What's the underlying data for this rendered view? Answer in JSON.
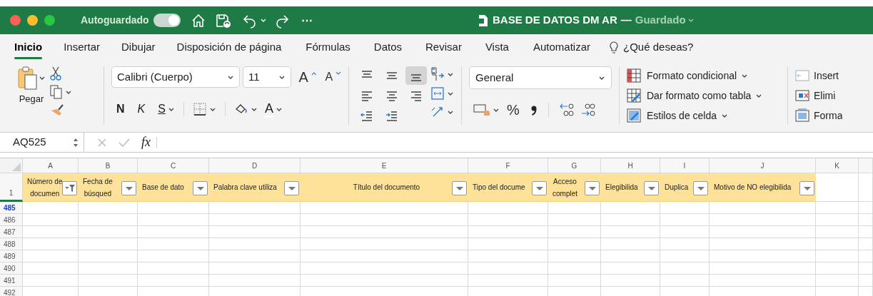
{
  "window": {
    "autosave_label": "Autoguardado",
    "autosave_on": true,
    "more": "⋯",
    "title": "BASE DE DATOS DM AR",
    "separator": "—",
    "status": "Guardado"
  },
  "ribbon_tabs": [
    {
      "label": "Inicio",
      "selected": true
    },
    {
      "label": "Insertar",
      "selected": false
    },
    {
      "label": "Dibujar",
      "selected": false
    },
    {
      "label": "Disposición de página",
      "selected": false
    },
    {
      "label": "Fórmulas",
      "selected": false
    },
    {
      "label": "Datos",
      "selected": false
    },
    {
      "label": "Revisar",
      "selected": false
    },
    {
      "label": "Vista",
      "selected": false
    },
    {
      "label": "Automatizar",
      "selected": false
    }
  ],
  "search": {
    "label": "¿Qué deseas?"
  },
  "clipboard": {
    "paste": "Pegar"
  },
  "font": {
    "name": "Calibri (Cuerpo)",
    "size": "11",
    "grow": "A",
    "shrink": "A",
    "bold": "N",
    "italic": "K",
    "underline": "S",
    "font_color_label": "A"
  },
  "alignment_buttons": [
    {
      "kind": "top",
      "selected": false
    },
    {
      "kind": "middle",
      "selected": false
    },
    {
      "kind": "bottom",
      "selected": true
    },
    {
      "kind": "left",
      "selected": false
    },
    {
      "kind": "center",
      "selected": false
    },
    {
      "kind": "right",
      "selected": false
    },
    {
      "kind": "outdent",
      "selected": false
    },
    {
      "kind": "indent",
      "selected": false
    }
  ],
  "number": {
    "format": "General",
    "percent": "%"
  },
  "styles": [
    "Formato condicional",
    "Dar formato como tabla",
    "Estilos de celda"
  ],
  "cells": [
    "Insert",
    "Elimi",
    "Forma"
  ],
  "formula_bar": {
    "name_box": "AQ525",
    "function": "fx"
  },
  "sheet": {
    "columns": [
      {
        "letter": "A",
        "header_lines": [
          "Número de",
          "documen"
        ],
        "filter_active": true
      },
      {
        "letter": "B",
        "header_lines": [
          "Fecha de",
          "búsqued"
        ],
        "filter_active": false
      },
      {
        "letter": "C",
        "header_lines": [
          "Base de dato"
        ],
        "filter_active": false
      },
      {
        "letter": "D",
        "header_lines": [
          "Palabra clave utiliza"
        ],
        "filter_active": false
      },
      {
        "letter": "E",
        "header_lines": [
          "Título del documento"
        ],
        "filter_active": false
      },
      {
        "letter": "F",
        "header_lines": [
          "Tipo del docume"
        ],
        "filter_active": false
      },
      {
        "letter": "G",
        "header_lines": [
          "Acceso",
          "complet"
        ],
        "filter_active": false
      },
      {
        "letter": "H",
        "header_lines": [
          "Elegibilida"
        ],
        "filter_active": false
      },
      {
        "letter": "I",
        "header_lines": [
          "Duplica"
        ],
        "filter_active": false
      },
      {
        "letter": "J",
        "header_lines": [
          "Motivo de NO elegibilida"
        ],
        "filter_active": false
      },
      {
        "letter": "K"
      }
    ],
    "header_row": "1",
    "rows": [
      {
        "number": "485",
        "highlighted": true
      },
      {
        "number": "486",
        "highlighted": false
      },
      {
        "number": "487",
        "highlighted": false
      },
      {
        "number": "488",
        "highlighted": false
      },
      {
        "number": "489",
        "highlighted": false
      },
      {
        "number": "490",
        "highlighted": false
      },
      {
        "number": "491",
        "highlighted": false
      },
      {
        "number": "492",
        "highlighted": false
      }
    ]
  }
}
